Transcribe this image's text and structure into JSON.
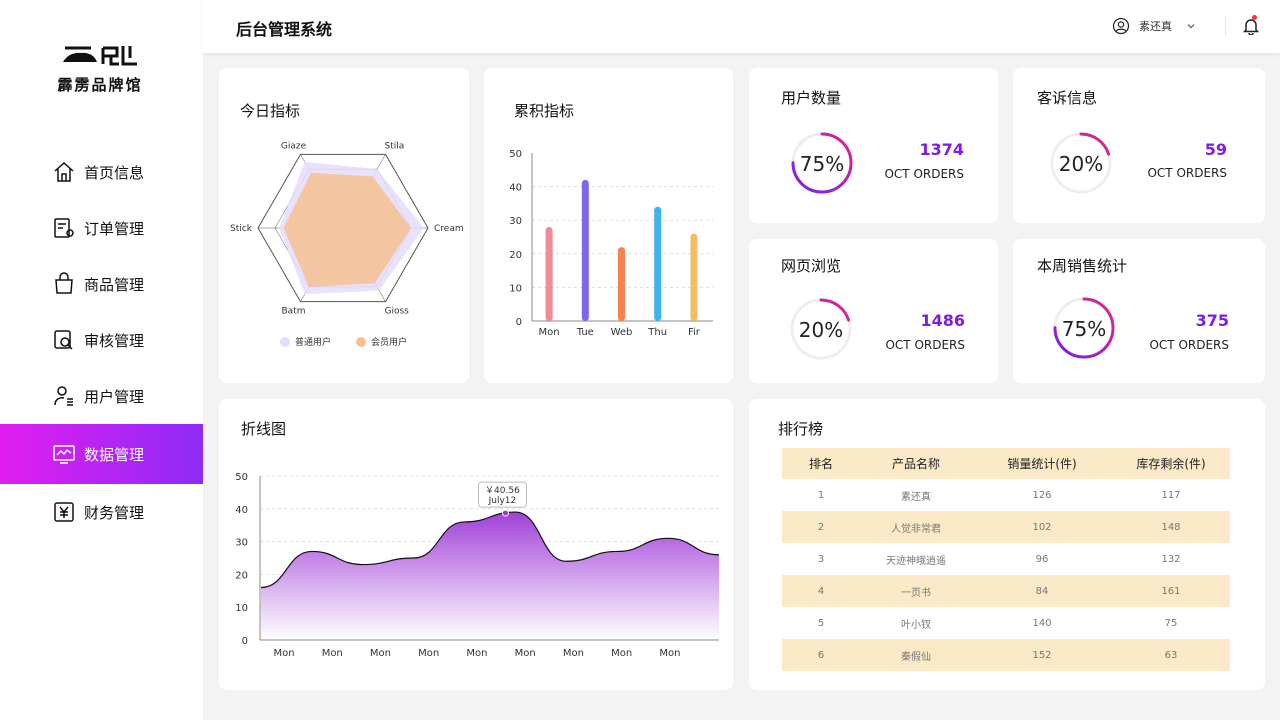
{
  "brand": {
    "name": "霹雳品牌馆"
  },
  "header": {
    "title": "后台管理系统",
    "username": "素还真"
  },
  "sidebar": {
    "items": [
      {
        "label": "首页信息",
        "icon": "home-icon"
      },
      {
        "label": "订单管理",
        "icon": "order-icon"
      },
      {
        "label": "商品管理",
        "icon": "shopping-bag-icon"
      },
      {
        "label": "审核管理",
        "icon": "review-icon"
      },
      {
        "label": "用户管理",
        "icon": "user-icon"
      },
      {
        "label": "数据管理",
        "icon": "monitor-chart-icon",
        "active": true
      },
      {
        "label": "财务管理",
        "icon": "yen-icon"
      }
    ]
  },
  "colors": {
    "accent_start": "#e01ef0",
    "accent_end": "#8e2bf5",
    "stat_number": "#7a1ee6",
    "table_stripe": "#fbe9c8"
  },
  "cards": {
    "radar": {
      "title": "今日指标"
    },
    "bar": {
      "title": "累积指标"
    },
    "users": {
      "title": "用户数量",
      "percent": "75%",
      "value": "1374",
      "sub": "OCT ORDERS",
      "fraction": 0.75
    },
    "complaints": {
      "title": "客诉信息",
      "percent": "20%",
      "value": "59",
      "sub": "OCT ORDERS",
      "fraction": 0.2
    },
    "pageviews": {
      "title": "网页浏览",
      "percent": "20%",
      "value": "1486",
      "sub": "OCT ORDERS",
      "fraction": 0.2
    },
    "weekly": {
      "title": "本周销售统计",
      "percent": "75%",
      "value": "375",
      "sub": "OCT ORDERS",
      "fraction": 0.75
    },
    "line": {
      "title": "折线图"
    },
    "ranking": {
      "title": "排行榜",
      "columns": [
        "排名",
        "产品名称",
        "销量统计(件)",
        "库存剩余(件)"
      ],
      "rows": [
        [
          "1",
          "素还真",
          "126",
          "117"
        ],
        [
          "2",
          "人觉非常君",
          "102",
          "148"
        ],
        [
          "3",
          "天迹神皒逍遥",
          "96",
          "132"
        ],
        [
          "4",
          "一页书",
          "84",
          "161"
        ],
        [
          "5",
          "叶小钗",
          "140",
          "75"
        ],
        [
          "6",
          "秦假仙",
          "152",
          "63"
        ]
      ]
    }
  },
  "chart_data": [
    {
      "type": "radar",
      "categories": [
        "Giaze",
        "Stila",
        "Cream",
        "Gioss",
        "Batm",
        "Stick"
      ],
      "max": 100,
      "series": [
        {
          "name": "普通用户",
          "values": [
            90,
            80,
            95,
            85,
            90,
            75
          ],
          "color": "#e6dcfb"
        },
        {
          "name": "会员用户",
          "values": [
            75,
            70,
            80,
            75,
            80,
            70
          ],
          "color": "#f4c08f"
        }
      ],
      "legend": "bottom"
    },
    {
      "type": "bar",
      "categories": [
        "Mon",
        "Tue",
        "Web",
        "Thu",
        "Fir"
      ],
      "values": [
        28,
        42,
        22,
        34,
        26
      ],
      "colors": [
        "#f28a97",
        "#7f67f0",
        "#f5834e",
        "#3fb2f5",
        "#f3be63"
      ],
      "ylim": [
        0,
        50
      ],
      "yticks": [
        0,
        10,
        20,
        30,
        40,
        50
      ],
      "grid": true
    },
    {
      "type": "area",
      "x": [
        "Mon",
        "Mon",
        "Mon",
        "Mon",
        "Mon",
        "Mon",
        "Mon",
        "Mon",
        "Mon"
      ],
      "values": [
        16,
        27,
        23,
        25,
        36,
        39,
        24,
        27,
        31,
        26
      ],
      "ylim": [
        0,
        50
      ],
      "yticks": [
        0,
        10,
        20,
        30,
        40,
        50
      ],
      "grid": true,
      "tooltip": {
        "value": "￥40.56",
        "label": "July12"
      }
    }
  ]
}
